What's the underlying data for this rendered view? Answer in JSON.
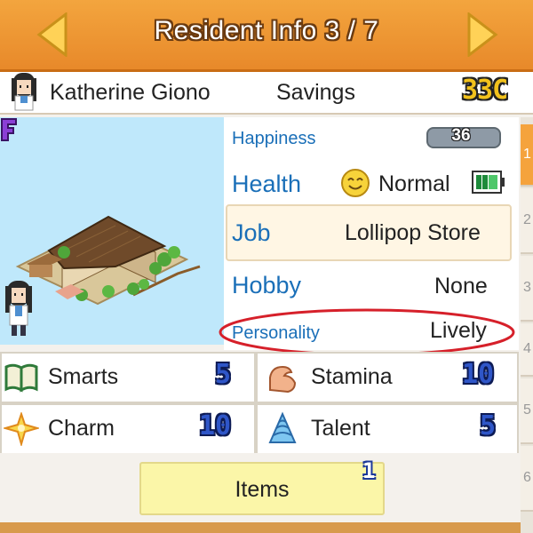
{
  "header": {
    "title": "Resident Info 3 / 7",
    "prev_icon": "left-arrow-icon",
    "next_icon": "right-arrow-icon"
  },
  "resident": {
    "name": "Katherine Giono",
    "savings_label": "Savings",
    "savings_value": "33C",
    "rank": "F"
  },
  "info": {
    "happiness_label": "Happiness",
    "happiness_value": "36",
    "health_label": "Health",
    "health_value": "Normal",
    "job_label": "Job",
    "job_value": "Lollipop Store",
    "hobby_label": "Hobby",
    "hobby_value": "None",
    "personality_label": "Personality",
    "personality_value": "Lively"
  },
  "stats": [
    {
      "label": "Smarts",
      "value": "5",
      "icon": "book-icon"
    },
    {
      "label": "Stamina",
      "value": "10",
      "icon": "flexed-arm-icon"
    },
    {
      "label": "Charm",
      "value": "10",
      "icon": "sparkle-icon"
    },
    {
      "label": "Talent",
      "value": "5",
      "icon": "blue-spiral-icon"
    }
  ],
  "items": {
    "label": "Items",
    "count": "1"
  },
  "side_tabs": [
    "1",
    "2",
    "3",
    "4",
    "5",
    "6"
  ],
  "colors": {
    "header": "#e8892a",
    "label_blue": "#1a6fb8",
    "annotation_red": "#d6202a",
    "items_button": "#fbf6a8"
  }
}
